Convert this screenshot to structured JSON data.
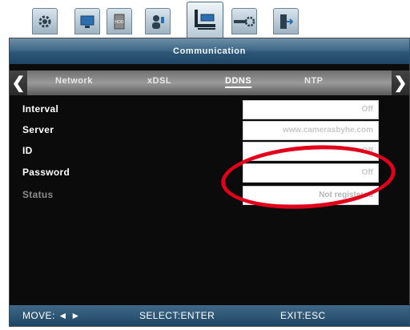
{
  "top_tabs": [
    {
      "name": "system",
      "icon": "gear-icon"
    },
    {
      "name": "display",
      "icon": "monitor-icon"
    },
    {
      "name": "storage",
      "icon": "hdd-icon"
    },
    {
      "name": "user",
      "icon": "user-icon"
    },
    {
      "name": "communication",
      "icon": "network-icon",
      "active": true
    },
    {
      "name": "device",
      "icon": "device-settings-icon"
    },
    {
      "name": "exit",
      "icon": "exit-door-icon"
    }
  ],
  "window": {
    "title": "Communication"
  },
  "subtabs": {
    "items": [
      "Network",
      "xDSL",
      "DDNS",
      "NTP"
    ],
    "active": "DDNS"
  },
  "rows": [
    {
      "label": "Interval",
      "value": "Off"
    },
    {
      "label": "Server",
      "value": "www.camerasbyhe.com"
    },
    {
      "label": "ID",
      "value": "Off"
    },
    {
      "label": "Password",
      "value": "Off"
    },
    {
      "label": "Status",
      "value": "Not registered"
    }
  ],
  "footer": {
    "move": "MOVE: ◄ ►",
    "select": "SELECT:ENTER",
    "exit": "EXIT:ESC"
  },
  "colors": {
    "title_bar": "#2d5676",
    "highlight_ring": "#e2001a"
  }
}
